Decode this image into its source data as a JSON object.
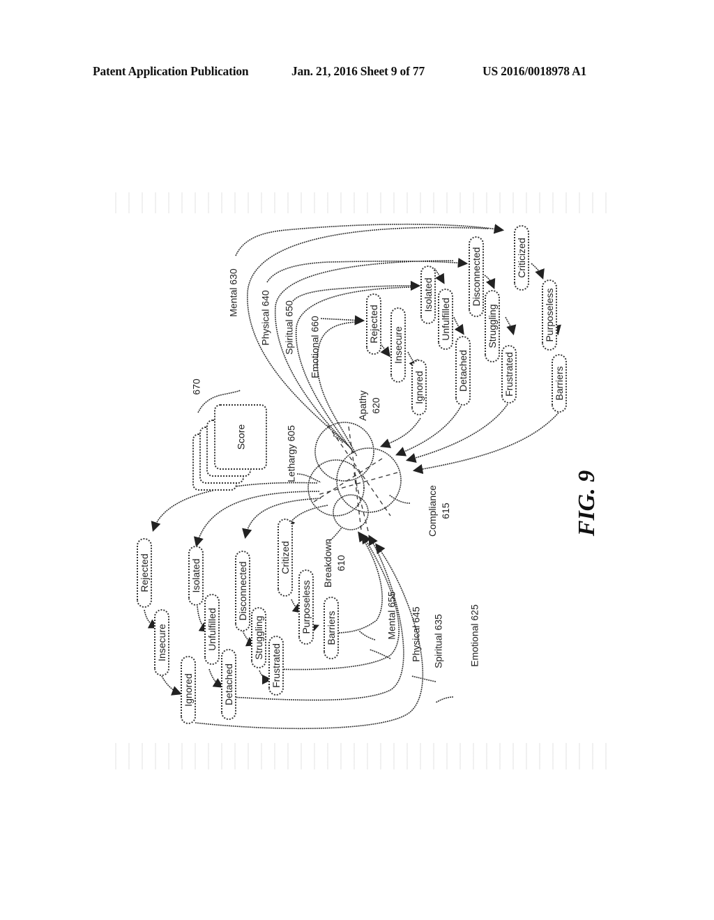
{
  "header": {
    "publication": "Patent Application Publication",
    "date_sheet": "Jan. 21, 2016  Sheet 9 of 77",
    "number": "US 2016/0018978 A1"
  },
  "figure": {
    "caption": "FIG. 9",
    "score_stack": {
      "label": "Score",
      "ref": "670"
    },
    "circles": {
      "lethargy": "Lethargy 605",
      "breakdown": [
        "Breakdown",
        "610"
      ],
      "compliance": [
        "Compliance",
        "615"
      ],
      "apathy": [
        "Apathy",
        "620"
      ]
    },
    "right_group": {
      "dimensions": {
        "mental": "Mental 630",
        "physical": "Physical 640",
        "spiritual": "Spiritual 650",
        "emotional": "Emotional 660"
      },
      "nodes": {
        "rejected": "Rejected",
        "insecure": "Insecure",
        "ignored": "Ignored",
        "isolated": "Isolated",
        "unfulfilled": "Unfulfilled",
        "detached": "Detached",
        "disconnected": "Disconnected",
        "struggling": "Struggling",
        "frustrated": "Frustrated",
        "criticized": "Criticized",
        "purposeless": "Purposeless",
        "barriers": "Barriers"
      }
    },
    "left_group": {
      "dimensions": {
        "mental": "Mental 655",
        "physical": "Physical 645",
        "spiritual": "Spiritual 635",
        "emotional": "Emotional 625"
      },
      "nodes": {
        "rejected": "Rejected",
        "insecure": "Insecure",
        "ignored": "Ignored",
        "isolated": "Isolated",
        "unfulfilled": "Unfulfilled",
        "detached": "Detached",
        "disconnected": "Disconnected",
        "struggling": "Struggling",
        "frustrated": "Frustrated",
        "criticized": "Critized",
        "purposeless": "Purposeless",
        "barriers": "Barriers"
      }
    }
  }
}
